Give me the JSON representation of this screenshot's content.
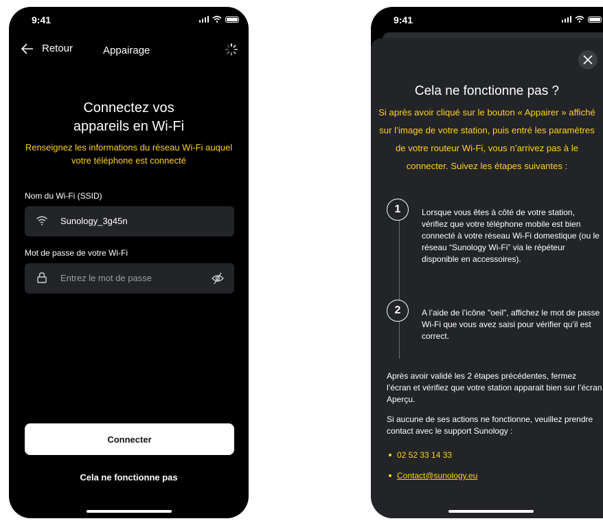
{
  "status_bar": {
    "time": "9:41"
  },
  "left_screen": {
    "back_label": "Retour",
    "title": "Appairage",
    "heading": "Connectez vos appareils en Wi-Fi",
    "subtitle": "Renseignez les informations du réseau Wi-Fi auquel votre téléphone est connecté",
    "ssid_label": "Nom du Wi-Fi (SSID)",
    "ssid_value": "Sunology_3g45n",
    "password_label": "Mot de passe de votre Wi-Fi",
    "password_placeholder": "Entrez le mot de passe",
    "connect_button": "Connecter",
    "help_link": "Cela ne fonctionne pas"
  },
  "right_screen": {
    "heading": "Cela ne fonctionne pas ?",
    "intro": "Si après avoir cliqué sur le bouton « Appairer » affiché sur l’image de votre station, puis entré les paramètres de votre routeur Wi-Fi, vous n’arrivez pas à le connecter. Suivez les étapes suivantes :",
    "steps": [
      {
        "number": "1",
        "text": "Lorsque vous êtes à côté de votre station, vérifiez que votre téléphone mobile est bien connecté à votre réseau Wi-Fi domestique (ou le réseau “Sunology Wi-Fi” via le répéteur disponible en accessoires)."
      },
      {
        "number": "2",
        "text": "A l’aide de l’icône \"oeil\", affichez le mot de passe Wi-Fi que vous avez saisi pour vérifier qu’il est correct."
      }
    ],
    "after_steps": "Après avoir validé les 2 étapes précédentes, fermez l’écran et vérifiez que votre station apparait bien sur l’écran Aperçu.",
    "support_text": "Si aucune de ses actions ne fonctionne, veuillez prendre contact avec le support Sunology :",
    "phone": "02 52 33 14 33",
    "email": "Contact@sunology.eu"
  },
  "colors": {
    "accent": "#FFD21F",
    "background": "#000000",
    "field_bg": "#232428",
    "sheet_bg": "#222427"
  }
}
